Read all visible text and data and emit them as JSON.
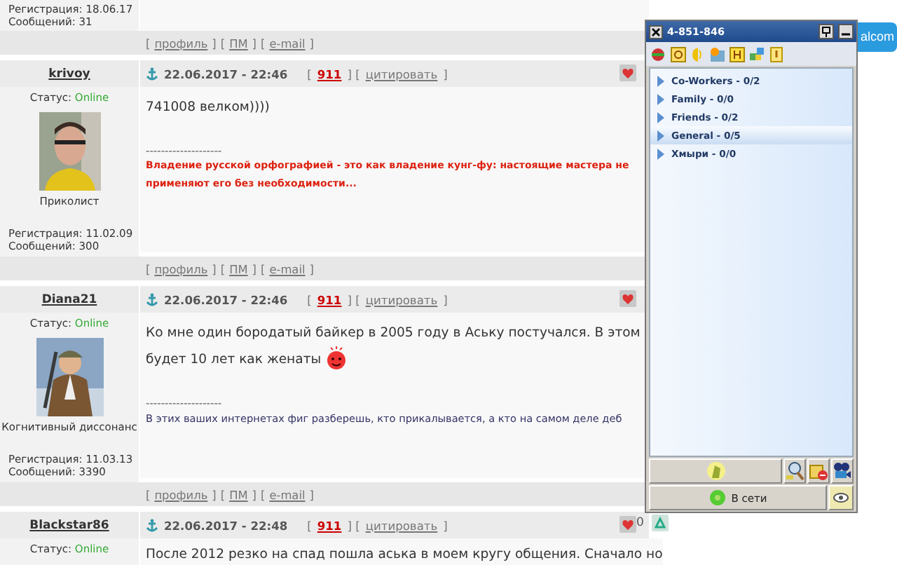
{
  "brackets": [
    "[",
    "]"
  ],
  "previous_post": {
    "registration": "Регистрация: 18.06.17",
    "messages": "Сообщений: 31",
    "footer_links": [
      "профиль",
      "ПМ",
      "e-mail"
    ]
  },
  "posts": [
    {
      "author": "krivoy",
      "date": "22.06.2017 - 22:46",
      "rating": "911",
      "quote": "цитировать",
      "status_label": "Статус:",
      "status": "Online",
      "user_title": "Приколист",
      "registration": "Регистрация: 11.02.09",
      "messages": "Сообщений: 300",
      "message": "741008 велком))))",
      "smiley": false,
      "separator": "--------------------",
      "signature": {
        "kind": "warning",
        "text": "Владение русской орфографией - это как владение кунг-фу: настоящие мастера не применяют его без необходимости..."
      },
      "footer_links": [
        "профиль",
        "ПМ",
        "e-mail"
      ]
    },
    {
      "author": "Diana21",
      "date": "22.06.2017 - 22:46",
      "rating": "911",
      "quote": "цитировать",
      "status_label": "Статус:",
      "status": "Online",
      "user_title": "Когнитивный диссонанс",
      "registration": "Регистрация: 11.03.13",
      "messages": "Сообщений: 3390",
      "message": "Ко мне один бородатый байкер в 2005 году в Аську постучался. В этом будет 10 лет как женаты",
      "smiley": true,
      "separator": "--------------------",
      "signature": {
        "kind": "plain",
        "text": "В этих ваших интернетах фиг разберешь, кто прикалывается, а кто на самом деле деб"
      },
      "footer_links": [
        "профиль",
        "ПМ",
        "e-mail"
      ]
    },
    {
      "author": "Blackstar86",
      "date": "22.06.2017 - 22:48",
      "rating": "911",
      "quote": "цитировать",
      "status_label": "Статус:",
      "status": "Online",
      "count": "0",
      "message": "После 2012 резко на спад пошла аська в моем кругу общения. Сначало но",
      "smiley": false
    }
  ],
  "ad_button": {
    "label": "alcom"
  },
  "icq": {
    "title": "4-851-846",
    "groups": [
      {
        "name": "Co-Workers - 0/2",
        "selected": false
      },
      {
        "name": "Family - 0/0",
        "selected": false
      },
      {
        "name": "Friends - 0/2",
        "selected": false
      },
      {
        "name": "General - 0/5",
        "selected": true
      },
      {
        "name": "Хмыри - 0/0",
        "selected": false
      }
    ],
    "status": "В сети"
  }
}
